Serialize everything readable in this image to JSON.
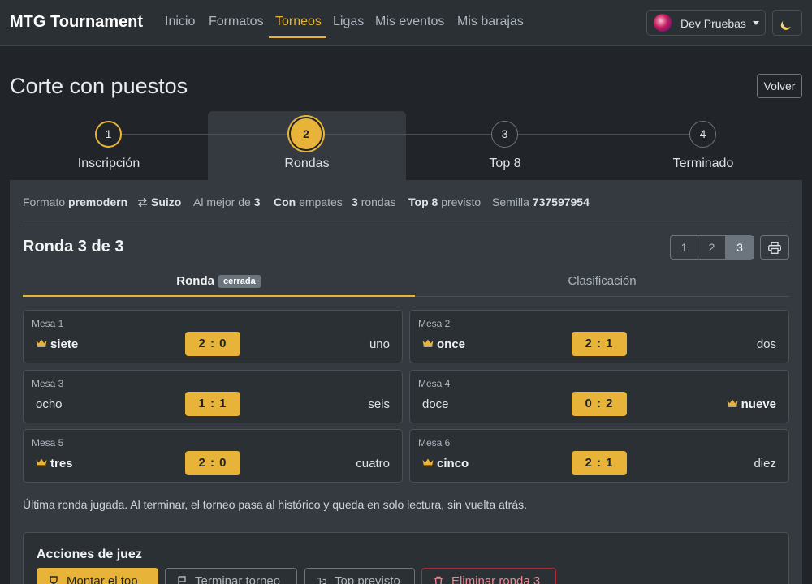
{
  "navbar": {
    "brand": "MTG Tournament",
    "items": [
      {
        "label": "Inicio"
      },
      {
        "label": "Formatos"
      },
      {
        "label": "Torneos",
        "active": true
      },
      {
        "label": "Ligas"
      },
      {
        "label": "Mis eventos"
      },
      {
        "label": "Mis barajas"
      }
    ],
    "user": "Dev Pruebas",
    "theme_icon": "moon-icon"
  },
  "header": {
    "title": "Corte con puestos",
    "back_label": "Volver"
  },
  "stepper": [
    {
      "number": "1",
      "label": "Inscripción",
      "state": "done"
    },
    {
      "number": "2",
      "label": "Rondas",
      "state": "current"
    },
    {
      "number": "3",
      "label": "Top 8",
      "state": "pending"
    },
    {
      "number": "4",
      "label": "Terminado",
      "state": "pending"
    }
  ],
  "meta": {
    "formato_label": "Formato",
    "formato_value": "premodern",
    "sistema": "Suizo",
    "mejor_de_label": "Al mejor de",
    "mejor_de_value": "3",
    "empates_strong": "Con",
    "empates_label": "empates",
    "rondas_value": "3",
    "rondas_label": "rondas",
    "top_strong": "Top 8",
    "top_label": "previsto",
    "semilla_label": "Semilla",
    "semilla_value": "737597954"
  },
  "round": {
    "title": "Ronda 3 de 3",
    "pages": [
      "1",
      "2",
      "3"
    ],
    "active_page": "3"
  },
  "tabs": {
    "ronda": "Ronda",
    "badge": "cerrada",
    "clasificacion": "Clasificación"
  },
  "matches": [
    {
      "mesa": "Mesa 1",
      "p1": "siete",
      "p2": "uno",
      "score": "2 : 0",
      "winner": "p1"
    },
    {
      "mesa": "Mesa 2",
      "p1": "once",
      "p2": "dos",
      "score": "2 : 1",
      "winner": "p1"
    },
    {
      "mesa": "Mesa 3",
      "p1": "ocho",
      "p2": "seis",
      "score": "1 : 1",
      "winner": "none"
    },
    {
      "mesa": "Mesa 4",
      "p1": "doce",
      "p2": "nueve",
      "score": "0 : 2",
      "winner": "p2"
    },
    {
      "mesa": "Mesa 5",
      "p1": "tres",
      "p2": "cuatro",
      "score": "2 : 0",
      "winner": "p1"
    },
    {
      "mesa": "Mesa 6",
      "p1": "cinco",
      "p2": "diez",
      "score": "2 : 1",
      "winner": "p1"
    }
  ],
  "note": "Última ronda jugada. Al terminar, el torneo pasa al histórico y queda en solo lectura, sin vuelta atrás.",
  "judge": {
    "title": "Acciones de juez",
    "buttons": [
      {
        "label": "Montar el top",
        "icon": "trophy-icon"
      },
      {
        "label": "Terminar torneo",
        "icon": "flag-icon"
      },
      {
        "label": "Top previsto",
        "icon": "bracket-icon"
      },
      {
        "label": "Eliminar ronda 3",
        "icon": "trash-icon"
      }
    ]
  },
  "colors": {
    "accent": "#e8b339",
    "background": "#212529",
    "panel": "#343a40",
    "danger": "#ea868f"
  }
}
